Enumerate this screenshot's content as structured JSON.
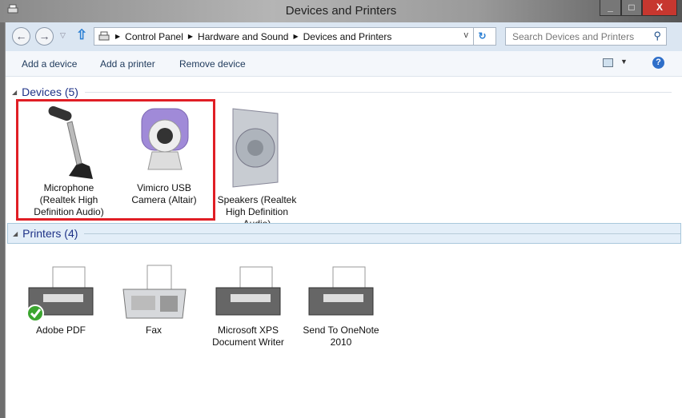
{
  "window": {
    "title": "Devices and Printers",
    "minimize": "_",
    "maximize": "□",
    "close": "X"
  },
  "address": {
    "crumbs": [
      "Control Panel",
      "Hardware and Sound",
      "Devices and Printers"
    ],
    "search_placeholder": "Search Devices and Printers"
  },
  "toolbar": {
    "add_device": "Add a device",
    "add_printer": "Add a printer",
    "remove_device": "Remove device"
  },
  "devices": {
    "header": "Devices (5)",
    "items": [
      {
        "label": "Microphone (Realtek High Definition Audio)"
      },
      {
        "label": "Vimicro USB Camera (Altair)"
      },
      {
        "label": "Speakers (Realtek High Definition Audio)"
      }
    ]
  },
  "printers": {
    "header": "Printers (4)",
    "items": [
      {
        "label": "Adobe PDF",
        "default": true
      },
      {
        "label": "Fax"
      },
      {
        "label": "Microsoft XPS Document Writer"
      },
      {
        "label": "Send To OneNote 2010"
      }
    ]
  },
  "colors": {
    "highlight": "#e01e25",
    "header_text": "#1e3287"
  }
}
